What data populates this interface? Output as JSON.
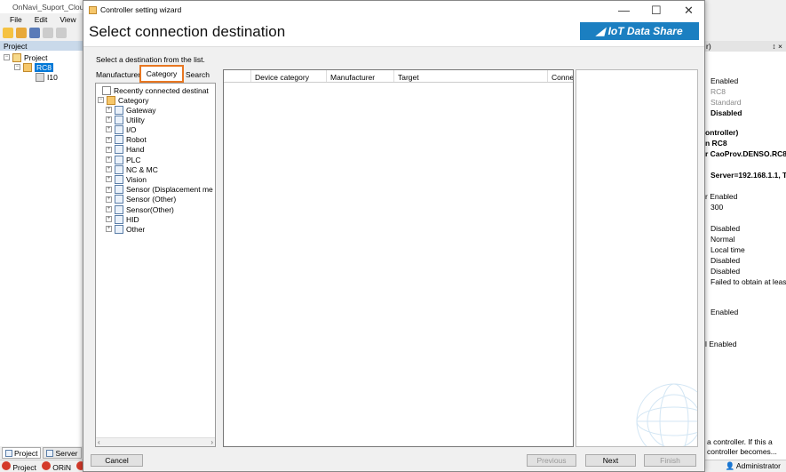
{
  "main_app": {
    "title": "OnNavi_Suport_Cloud",
    "menu": [
      "File",
      "Edit",
      "View"
    ],
    "project_header": "Project",
    "tree": {
      "root": "Project",
      "controller": "RC8",
      "child": "I10"
    },
    "bottom_tabs": [
      {
        "label": "Project",
        "selected": true
      },
      {
        "label": "Server",
        "selected": false
      }
    ],
    "status_items": [
      "Project",
      "ORiN",
      "",
      ""
    ],
    "status_user": "Administrator"
  },
  "right_panel": {
    "header": "r)",
    "pin": "↕ ×",
    "rows": [
      {
        "text": "Enabled",
        "bold": false,
        "indent": 6
      },
      {
        "text": "RC8",
        "bold": false,
        "indent": 6,
        "gray": true
      },
      {
        "text": "Standard",
        "bold": false,
        "indent": 6,
        "gray": true
      },
      {
        "text": "Disabled",
        "bold": true,
        "indent": 6
      },
      {
        "text": "ontroller)",
        "bold": true,
        "indent": 0
      },
      {
        "text": "n RC8",
        "bold": true,
        "indent": 0
      },
      {
        "text": "r CaoProv.DENSO.RC8",
        "bold": true,
        "indent": 0
      },
      {
        "text": "Server=192.168.1.1, T",
        "bold": true,
        "indent": 6
      },
      {
        "text": "r Enabled",
        "bold": false,
        "indent": 0
      },
      {
        "text": "300",
        "bold": false,
        "indent": 6
      },
      {
        "text": "Disabled",
        "bold": false,
        "indent": 6
      },
      {
        "text": "Normal",
        "bold": false,
        "indent": 6
      },
      {
        "text": "Local time",
        "bold": false,
        "indent": 6
      },
      {
        "text": "Disabled",
        "bold": false,
        "indent": 6
      },
      {
        "text": "Disabled",
        "bold": false,
        "indent": 6
      },
      {
        "text": "Failed to obtain at least",
        "bold": false,
        "indent": 6
      },
      {
        "text": "Enabled",
        "bold": false,
        "indent": 6
      },
      {
        "text": "l Enabled",
        "bold": false,
        "indent": 0
      }
    ],
    "footer": "a controller. If this a controller becomes..."
  },
  "dialog": {
    "title": "Controller setting wizard",
    "window_controls": {
      "minimize": "—",
      "maximize": "☐",
      "close": "✕"
    },
    "heading": "Select connection destination",
    "logo_text": "IoT Data Share",
    "hint": "Select a destination from the list.",
    "tabs": {
      "manufacturer": "Manufacturer",
      "category": "Category",
      "search": "Search"
    },
    "tree": {
      "recent": "Recently connected destinat",
      "root": "Category",
      "items": [
        "Gateway",
        "Utility",
        "I/O",
        "Robot",
        "Hand",
        "PLC",
        "NC & MC",
        "Vision",
        "Sensor (Displacement me",
        "Sensor (Other)",
        "Sensor(Other)",
        "HID",
        "Other"
      ]
    },
    "columns": [
      "Device category",
      "Manufacturer",
      "Target",
      "Conne"
    ],
    "buttons": {
      "cancel": "Cancel",
      "previous": "Previous",
      "next": "Next",
      "finish": "Finish"
    }
  },
  "colors": {
    "accent": "#e87722",
    "logo_bg": "#1b7fc1",
    "status_icon": "#d43a2a"
  }
}
